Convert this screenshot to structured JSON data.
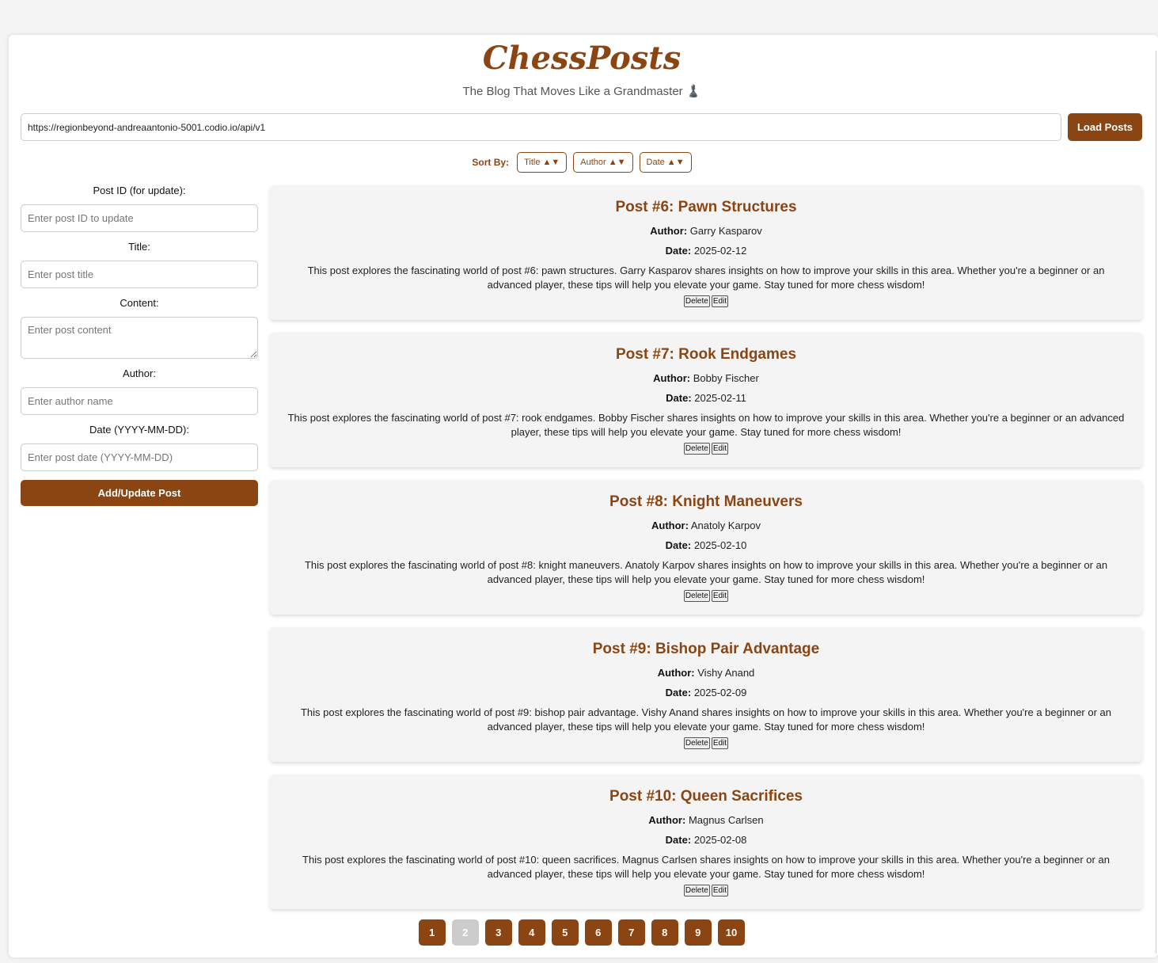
{
  "header": {
    "title": "ChessPosts",
    "subtitle": "The Blog That Moves Like a Grandmaster ♟️"
  },
  "api": {
    "url_value": "https://regionbeyond-andreaantonio-5001.codio.io/api/v1",
    "load_label": "Load Posts"
  },
  "sort": {
    "label": "Sort By:",
    "buttons": [
      "Title ▲▼",
      "Author ▲▼",
      "Date ▲▼"
    ]
  },
  "form": {
    "id_label": "Post ID (for update):",
    "id_placeholder": "Enter post ID to update",
    "title_label": "Title:",
    "title_placeholder": "Enter post title",
    "content_label": "Content:",
    "content_placeholder": "Enter post content",
    "author_label": "Author:",
    "author_placeholder": "Enter author name",
    "date_label": "Date (YYYY-MM-DD):",
    "date_placeholder": "Enter post date (YYYY-MM-DD)",
    "submit_label": "Add/Update Post"
  },
  "labels": {
    "author": "Author:",
    "date": "Date:",
    "delete": "Delete",
    "edit": "Edit"
  },
  "posts": [
    {
      "title": "Post #6: Pawn Structures",
      "author": "Garry Kasparov",
      "date": "2025-02-12",
      "content": "This post explores the fascinating world of post #6: pawn structures. Garry Kasparov shares insights on how to improve your skills in this area. Whether you're a beginner or an advanced player, these tips will help you elevate your game. Stay tuned for more chess wisdom!"
    },
    {
      "title": "Post #7: Rook Endgames",
      "author": "Bobby Fischer",
      "date": "2025-02-11",
      "content": "This post explores the fascinating world of post #7: rook endgames. Bobby Fischer shares insights on how to improve your skills in this area. Whether you're a beginner or an advanced player, these tips will help you elevate your game. Stay tuned for more chess wisdom!"
    },
    {
      "title": "Post #8: Knight Maneuvers",
      "author": "Anatoly Karpov",
      "date": "2025-02-10",
      "content": "This post explores the fascinating world of post #8: knight maneuvers. Anatoly Karpov shares insights on how to improve your skills in this area. Whether you're a beginner or an advanced player, these tips will help you elevate your game. Stay tuned for more chess wisdom!"
    },
    {
      "title": "Post #9: Bishop Pair Advantage",
      "author": "Vishy Anand",
      "date": "2025-02-09",
      "content": "This post explores the fascinating world of post #9: bishop pair advantage. Vishy Anand shares insights on how to improve your skills in this area. Whether you're a beginner or an advanced player, these tips will help you elevate your game. Stay tuned for more chess wisdom!"
    },
    {
      "title": "Post #10: Queen Sacrifices",
      "author": "Magnus Carlsen",
      "date": "2025-02-08",
      "content": "This post explores the fascinating world of post #10: queen sacrifices. Magnus Carlsen shares insights on how to improve your skills in this area. Whether you're a beginner or an advanced player, these tips will help you elevate your game. Stay tuned for more chess wisdom!"
    }
  ],
  "pagination": {
    "pages": [
      "1",
      "2",
      "3",
      "4",
      "5",
      "6",
      "7",
      "8",
      "9",
      "10"
    ],
    "current": "2"
  },
  "colors": {
    "brand": "#8B4513",
    "page_background": "#f4f4f4",
    "card_background": "#f4f4f4",
    "current_page": "#cccccc"
  }
}
